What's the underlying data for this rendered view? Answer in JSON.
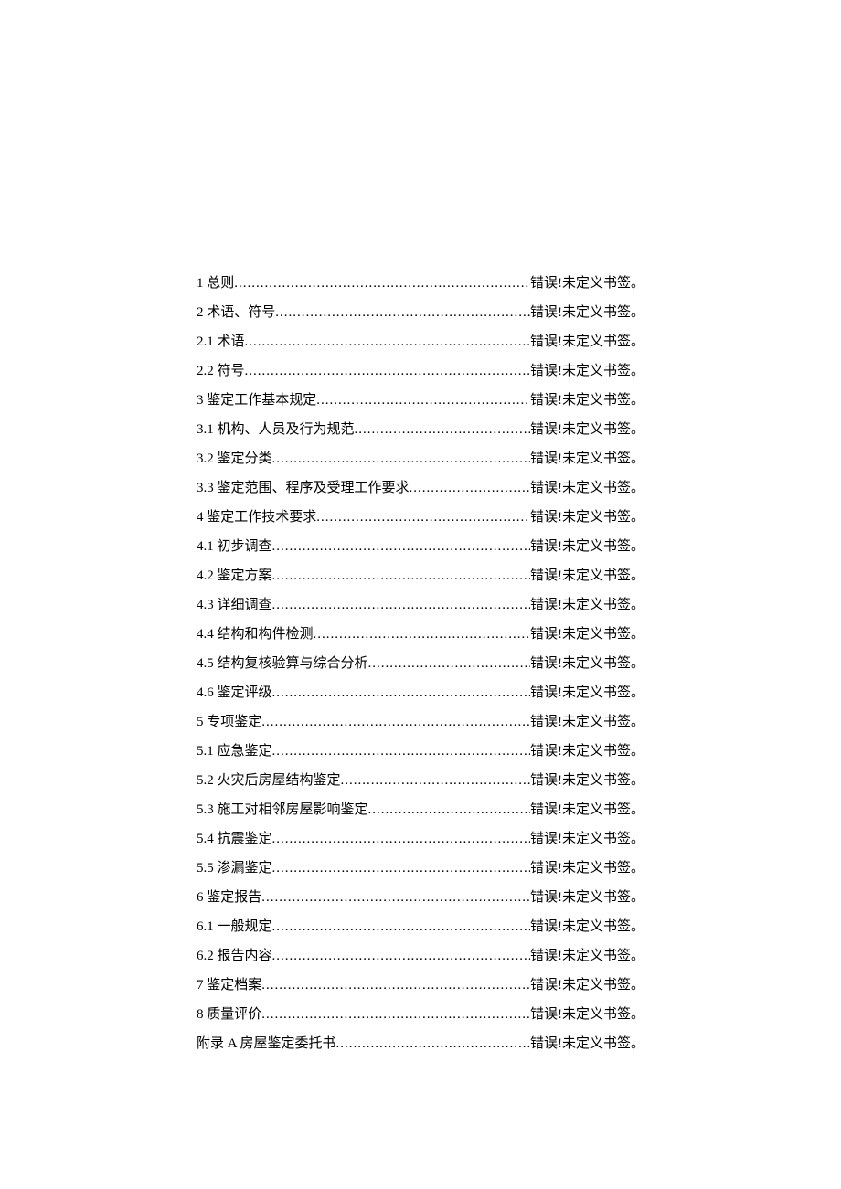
{
  "toc": {
    "error_text": "错误!未定义书签。",
    "entries": [
      {
        "title": "1 总则"
      },
      {
        "title": "2 术语、符号"
      },
      {
        "title": "2.1  术语"
      },
      {
        "title": "2.2  符号"
      },
      {
        "title": "3 鉴定工作基本规定"
      },
      {
        "title": "3.1  机构、人员及行为规范"
      },
      {
        "title": "3.2  鉴定分类"
      },
      {
        "title": "3.3  鉴定范围、程序及受理工作要求"
      },
      {
        "title": "4 鉴定工作技术要求"
      },
      {
        "title": "4.1  初步调查"
      },
      {
        "title": "4.2  鉴定方案"
      },
      {
        "title": "4.3  详细调查"
      },
      {
        "title": "4.4  结构和构件检测"
      },
      {
        "title": "4.5  结构复核验算与综合分析"
      },
      {
        "title": "4.6  鉴定评级"
      },
      {
        "title": "5 专项鉴定"
      },
      {
        "title": "5.1  应急鉴定"
      },
      {
        "title": "5.2  火灾后房屋结构鉴定"
      },
      {
        "title": "5.3  施工对相邻房屋影响鉴定"
      },
      {
        "title": "5.4  抗震鉴定"
      },
      {
        "title": "5.5  渗漏鉴定"
      },
      {
        "title": "6 鉴定报告"
      },
      {
        "title": "6.1  一般规定"
      },
      {
        "title": "6.2  报告内容"
      },
      {
        "title": "7 鉴定档案"
      },
      {
        "title": "8 质量评价"
      },
      {
        "title": "附录 A 房屋鉴定委托书 "
      }
    ]
  }
}
